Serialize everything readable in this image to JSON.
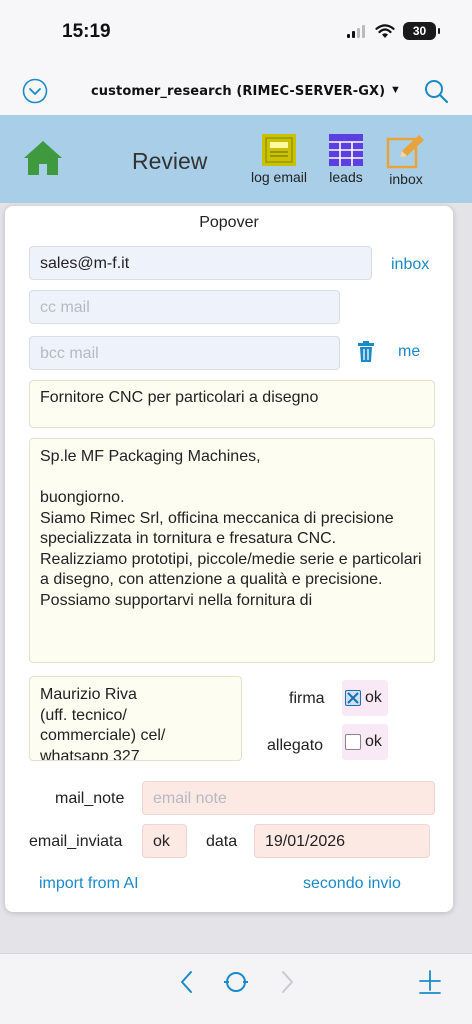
{
  "status_bar": {
    "time": "15:19",
    "battery": "30"
  },
  "nav": {
    "title": "customer_research (RIMEC-SERVER-GX)",
    "caret": "▼"
  },
  "toolbar": {
    "title": "Review",
    "log_email_label": "log email",
    "leads_label": "leads",
    "inbox_label": "inbox"
  },
  "popover": {
    "title": "Popover",
    "to_value": "sales@m-f.it",
    "inbox_link": "inbox",
    "cc_placeholder": "cc mail",
    "bcc_placeholder": "bcc mail",
    "me_link": "me",
    "subject": "Fornitore CNC per particolari a disegno",
    "body": "Sp.le MF Packaging Machines,\n\nbuongiorno.\nSiamo Rimec Srl, officina meccanica di precisione specializzata in tornitura e fresatura CNC.\nRealizziamo prototipi, piccole/medie serie e particolari a disegno, con attenzione a qualità e precisione.\nPossiamo supportarvi nella fornitura di",
    "signature": "Maurizio Riva\n(uff. tecnico/\ncommerciale) cel/\nwhatsapp 327",
    "firma_label": "firma",
    "firma_ok": "ok",
    "firma_checked": true,
    "allegato_label": "allegato",
    "allegato_ok": "ok",
    "allegato_checked": false,
    "mail_note_label": "mail_note",
    "mail_note_placeholder": "email note",
    "email_inviata_label": "email_inviata",
    "email_inviata_value": "ok",
    "data_label": "data",
    "data_value": "19/01/2026",
    "import_link": "import from AI",
    "secondo_link": "secondo invio"
  },
  "colors": {
    "accent": "#1a8ac9",
    "toolbar_bg": "#a9cfe8",
    "home_green": "#3f9a3f",
    "log_email_icon": "#c8c200",
    "leads_icon": "#5b3fe0",
    "inbox_icon": "#e8a33a"
  },
  "icons": [
    "chevron-down-circle-icon",
    "search-icon",
    "home-icon",
    "log-email-icon",
    "leads-grid-icon",
    "inbox-edit-icon",
    "trash-icon",
    "back-icon",
    "refresh-icon",
    "forward-icon",
    "add-icon"
  ]
}
